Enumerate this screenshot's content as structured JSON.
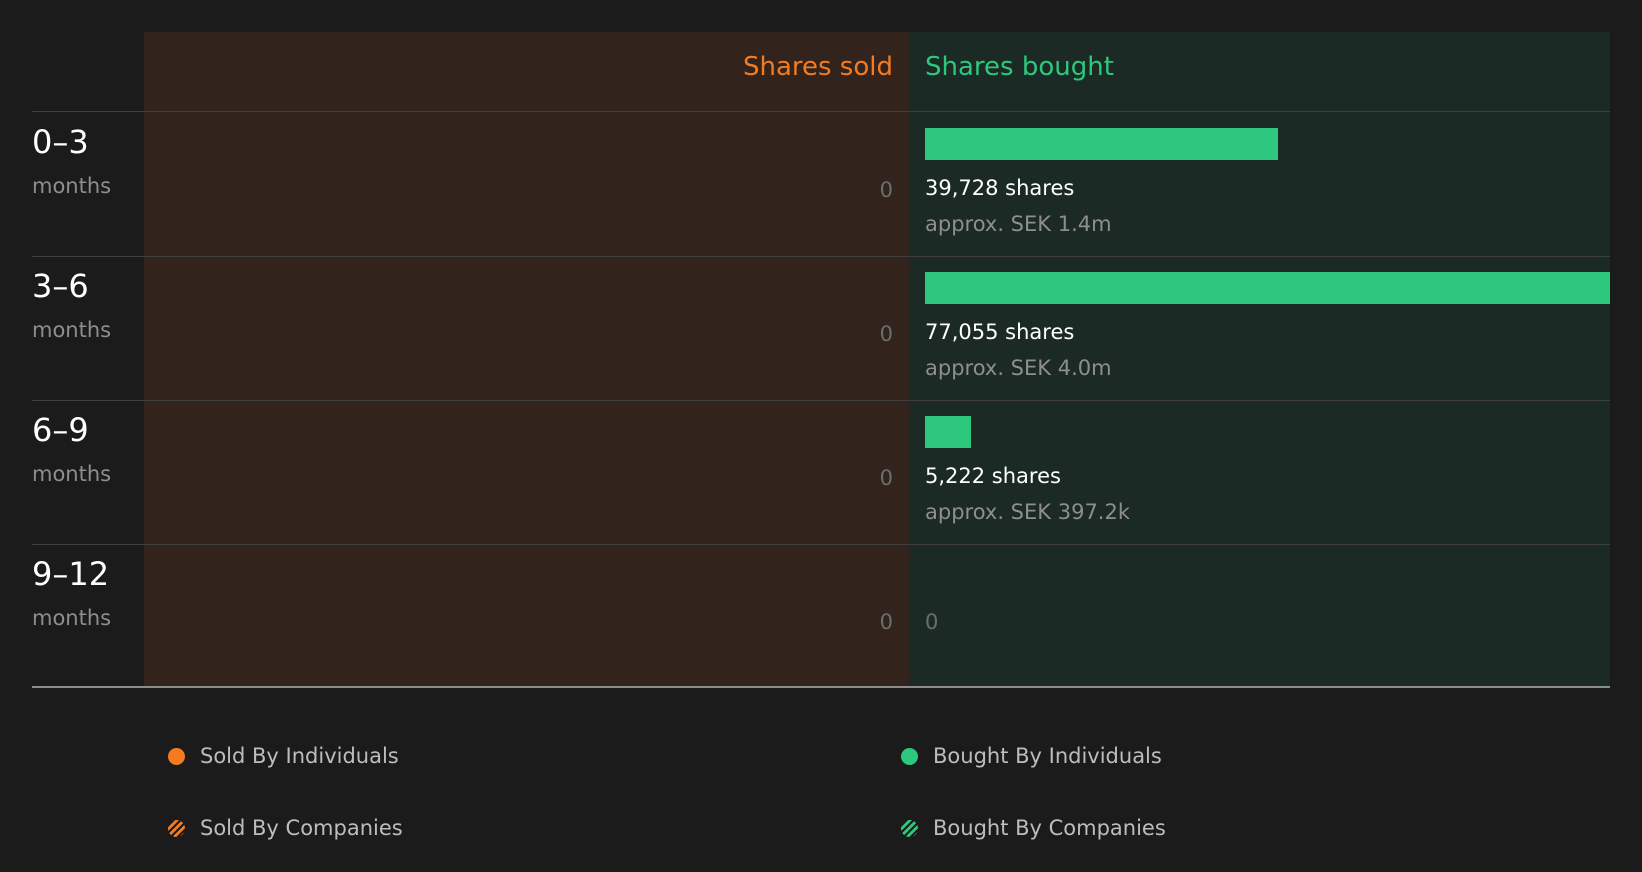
{
  "colors": {
    "sold": "#f47b20",
    "bought": "#2dc87e",
    "sold_panel": "#32231c",
    "bought_panel": "#1b2a24",
    "background": "#1b1b1b"
  },
  "header": {
    "sold": "Shares sold",
    "bought": "Shares bought"
  },
  "rows": [
    {
      "period": "0–3",
      "unit": "months",
      "sold": "0",
      "bought_shares": "39,728 shares",
      "bought_value": "approx. SEK 1.4m"
    },
    {
      "period": "3–6",
      "unit": "months",
      "sold": "0",
      "bought_shares": "77,055 shares",
      "bought_value": "approx. SEK 4.0m"
    },
    {
      "period": "6–9",
      "unit": "months",
      "sold": "0",
      "bought_shares": "5,222 shares",
      "bought_value": "approx. SEK 397.2k"
    },
    {
      "period": "9–12",
      "unit": "months",
      "sold": "0",
      "bought_zero": "0"
    }
  ],
  "legend": {
    "sold_individuals": "Sold By Individuals",
    "bought_individuals": "Bought By Individuals",
    "sold_companies": "Sold By Companies",
    "bought_companies": "Bought By Companies"
  },
  "chart_data": {
    "type": "bar",
    "categories": [
      "0–3 months",
      "3–6 months",
      "6–9 months",
      "9–12 months"
    ],
    "series": [
      {
        "name": "Shares sold",
        "values": [
          0,
          0,
          0,
          0
        ]
      },
      {
        "name": "Shares bought",
        "values": [
          39728,
          77055,
          5222,
          0
        ]
      }
    ],
    "bought_value_sek": [
      "1.4m",
      "4.0m",
      "397.2k",
      ""
    ],
    "legend_position": "bottom"
  }
}
